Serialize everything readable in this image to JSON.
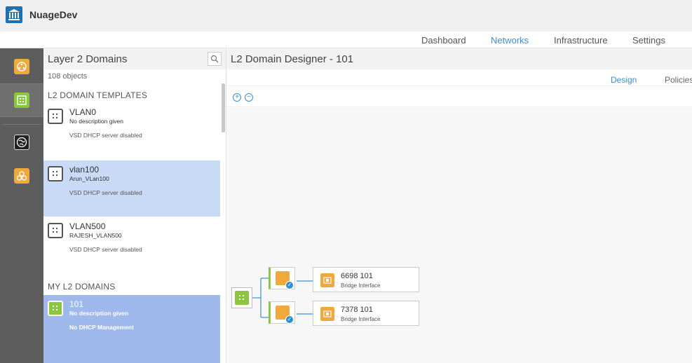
{
  "app": {
    "title": "NuageDev",
    "logo_icon": "bank-icon"
  },
  "nav": [
    {
      "label": "Dashboard",
      "active": false
    },
    {
      "label": "Networks",
      "active": true
    },
    {
      "label": "Infrastructure",
      "active": false
    },
    {
      "label": "Settings",
      "active": false
    }
  ],
  "rail": [
    {
      "icon": "network-macro-icon",
      "color": "#f2a93b",
      "active": false
    },
    {
      "icon": "l2-domain-icon",
      "color": "#8cc63f",
      "active": true
    },
    {
      "icon": "globe-icon",
      "color": "#222222",
      "active": false
    },
    {
      "icon": "shared-resources-icon",
      "color": "#f2a93b",
      "active": false
    }
  ],
  "list_panel": {
    "title": "Layer 2 Domains",
    "count": "108 objects",
    "templates_heading": "L2 DOMAIN TEMPLATES",
    "my_domains_heading": "MY L2 DOMAINS",
    "templates": [
      {
        "name": "VLAN0",
        "description": "No description given",
        "dhcp": "VSD DHCP server disabled",
        "selected": false
      },
      {
        "name": "vlan100",
        "description": "Arun_VLan100",
        "dhcp": "VSD DHCP server disabled",
        "selected": true
      },
      {
        "name": "VLAN500",
        "description": "RAJESH_VLAN500",
        "dhcp": "VSD DHCP server disabled",
        "selected": false
      }
    ],
    "domains": [
      {
        "name": "101",
        "description": "No description given",
        "dhcp": "No DHCP Management",
        "selected": true
      }
    ]
  },
  "designer": {
    "title": "L2 Domain Designer - 101",
    "tabs": [
      {
        "label": "Design",
        "active": true
      },
      {
        "label": "Policies",
        "active": false
      }
    ],
    "zoom_in": "+",
    "zoom_out": "−",
    "nodes": [
      {
        "name": "6698 101",
        "type": "Bridge Interface"
      },
      {
        "name": "7378 101",
        "type": "Bridge Interface"
      }
    ]
  },
  "colors": {
    "accent": "#3b8fd6",
    "green": "#8cc63f",
    "orange": "#f2a93b",
    "rail": "#5d5d5d"
  }
}
